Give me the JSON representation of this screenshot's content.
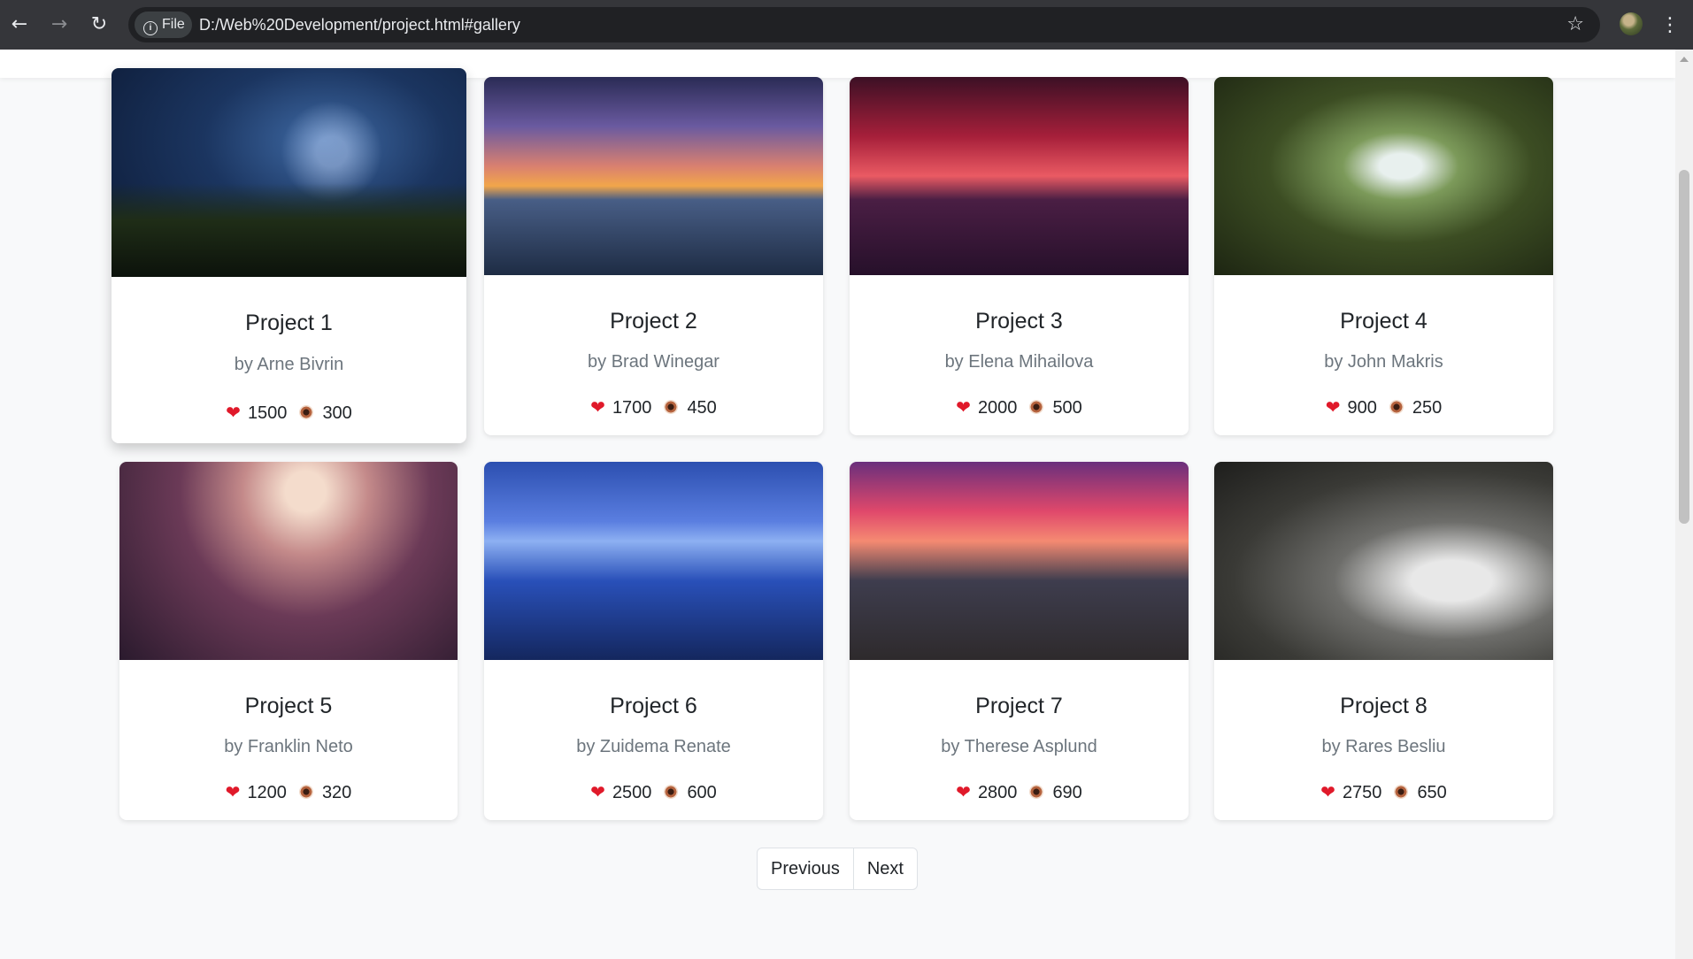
{
  "browser": {
    "file_chip_label": "File",
    "url": "D:/Web%20Development/project.html#gallery"
  },
  "gallery": {
    "projects": [
      {
        "title": "Project 1",
        "author": "by Arne Bivrin",
        "likes": "1500",
        "views": "300"
      },
      {
        "title": "Project 2",
        "author": "by Brad Winegar",
        "likes": "1700",
        "views": "450"
      },
      {
        "title": "Project 3",
        "author": "by Elena Mihailova",
        "likes": "2000",
        "views": "500"
      },
      {
        "title": "Project 4",
        "author": "by John Makris",
        "likes": "900",
        "views": "250"
      },
      {
        "title": "Project 5",
        "author": "by Franklin Neto",
        "likes": "1200",
        "views": "320"
      },
      {
        "title": "Project 6",
        "author": "by Zuidema Renate",
        "likes": "2500",
        "views": "600"
      },
      {
        "title": "Project 7",
        "author": "by Therese Asplund",
        "likes": "2800",
        "views": "690"
      },
      {
        "title": "Project 8",
        "author": "by Rares Besliu",
        "likes": "2750",
        "views": "650"
      }
    ]
  },
  "pagination": {
    "previous_label": "Previous",
    "next_label": "Next"
  },
  "icons": {
    "like": "heart-icon",
    "views": "eye-icon"
  }
}
